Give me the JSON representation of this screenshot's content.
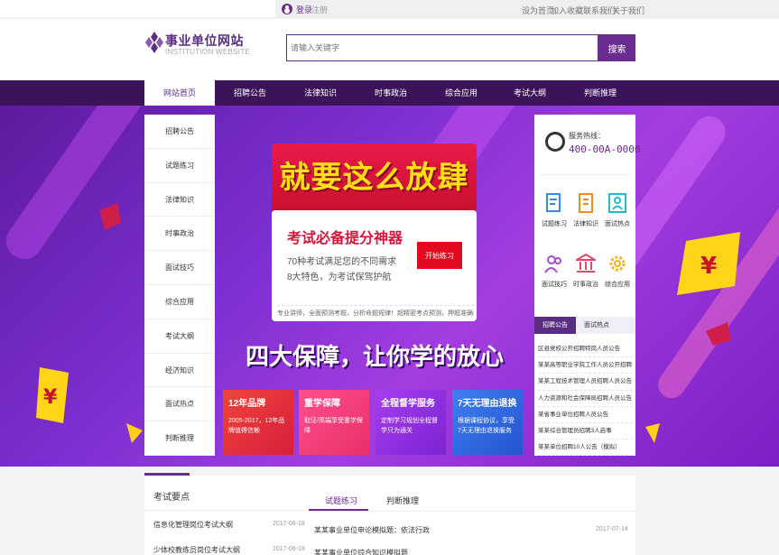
{
  "topbar": {
    "login": "登录",
    "register": "注册",
    "links": [
      "设为首页",
      "加入收藏",
      "联系我们",
      "关于我们"
    ]
  },
  "header": {
    "logo_cn": "事业单位网站",
    "logo_en": "INSTITUTION WEBSITE",
    "search_placeholder": "请输入关键字",
    "search_button": "搜索"
  },
  "nav": {
    "items": [
      "网站首页",
      "招聘公告",
      "法律知识",
      "时事政治",
      "综合应用",
      "考试大纲",
      "判断推理"
    ],
    "active_index": 0
  },
  "sidebar": {
    "items": [
      "招聘公告",
      "试题练习",
      "法律知识",
      "时事政治",
      "面试技巧",
      "综合应用",
      "考试大纲",
      "经济知识",
      "面试热点",
      "判断推理"
    ]
  },
  "banner": {
    "slogan": "就要这么放肆",
    "card_title": "考试必备提分神器",
    "card_line1": "70种考试满足您的不同需求",
    "card_line2": "8大特色，为考试保驾护航",
    "practice_button": "开始练习",
    "card_footer": "专业讲师，全面预测考题，分析命题规律！超精密考点预测，押题准确率高。",
    "guarantee": "四大保障，让你学的放心",
    "features": [
      {
        "title": "12年品牌",
        "desc": "2005-2017，12年品牌值得信赖",
        "color": "#e8323c"
      },
      {
        "title": "重学保障",
        "desc": "取证/高端享受重学保障",
        "color": "#f0357a"
      },
      {
        "title": "全程督学服务",
        "desc": "定制学习规划全程督学只为通关",
        "color": "#8a2fd8"
      },
      {
        "title": "7天无理由退换",
        "desc": "根据课程协议，享受7天无理由退换服务",
        "color": "#2e6be0"
      }
    ]
  },
  "rightpanel": {
    "hotline_label": "服务热线：",
    "hotline_number": "400-00A-0000",
    "quick_links": [
      "试题练习",
      "法律知识",
      "面试热点",
      "面试技巧",
      "时事政治",
      "综合应用"
    ],
    "tabs": [
      "招聘公告",
      "面试热点"
    ],
    "active_tab": 0,
    "notices": [
      "区县党校公开招聘特岗人员公告",
      "某某高等职业学院工作人员公开招聘公告",
      "某某工程技术管理人员招聘人员公告",
      "人力资源和社会保障局招聘人员公告",
      "某省事业单位招聘人员公告",
      "某某综合管理员招聘3人启事",
      "某某单位招聘10人公告（模拟）"
    ]
  },
  "bottom": {
    "left_heading": "考试要点",
    "left_items": [
      {
        "title": "信息化管理岗位考试大纲",
        "date": "2017-08-18"
      },
      {
        "title": "少体校教练员岗位考试大纲",
        "date": "2017-08-18"
      }
    ],
    "tabs": [
      "试题练习",
      "判断推理"
    ],
    "active_tab": 0,
    "right_items": [
      {
        "title": "某某事业单位申论模拟题：依法行政",
        "date": "2017-07-14"
      },
      {
        "title": "某某事业单位综合知识模拟题",
        "date": ""
      }
    ]
  },
  "colors": {
    "brand": "#6a2c91",
    "nav_bg": "#3c1258",
    "accent_red": "#d8143a",
    "slogan_yellow": "#ffe014"
  }
}
